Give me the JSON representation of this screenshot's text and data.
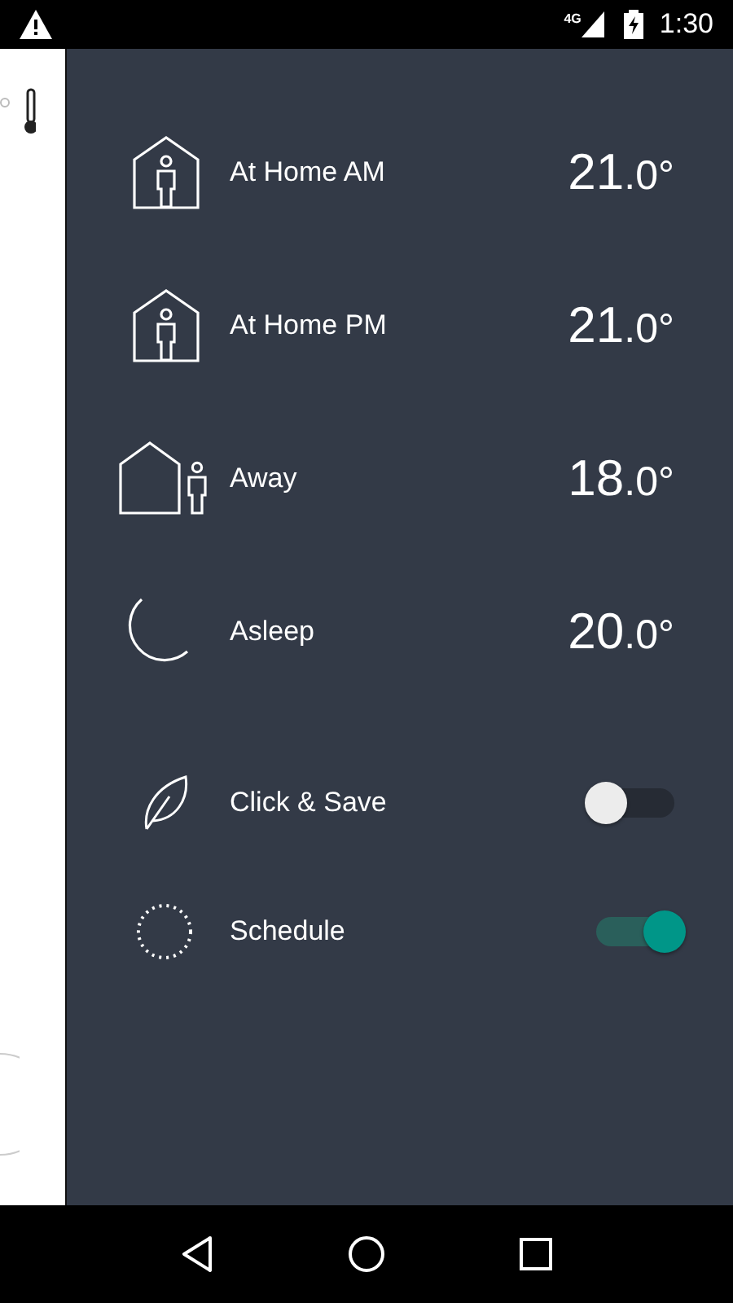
{
  "status_bar": {
    "time": "1:30",
    "network": "4G"
  },
  "modes": [
    {
      "kind": "home",
      "label": "At Home AM",
      "whole": "21",
      "fraction": ".0°"
    },
    {
      "kind": "home",
      "label": "At Home PM",
      "whole": "21",
      "fraction": ".0°"
    },
    {
      "kind": "away",
      "label": "Away",
      "whole": "18",
      "fraction": ".0°"
    },
    {
      "kind": "asleep",
      "label": "Asleep",
      "whole": "20",
      "fraction": ".0°"
    }
  ],
  "settings": [
    {
      "kind": "leaf",
      "label": "Click & Save",
      "on": false
    },
    {
      "kind": "schedule",
      "label": "Schedule",
      "on": true
    }
  ]
}
